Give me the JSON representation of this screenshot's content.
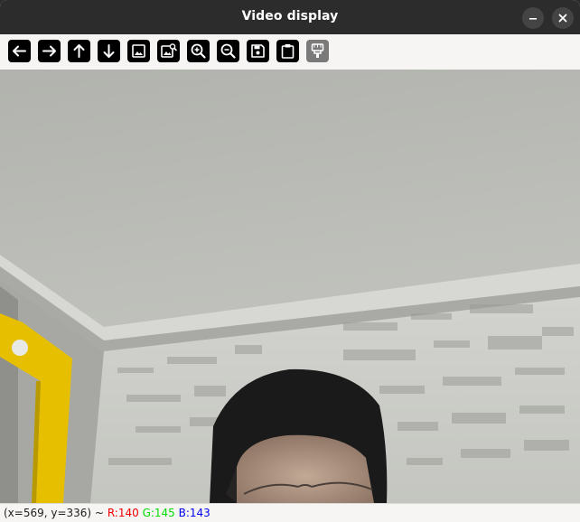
{
  "window": {
    "title": "Video display"
  },
  "titlebar_buttons": [
    {
      "name": "minimize",
      "icon": "minimize-icon"
    },
    {
      "name": "close",
      "icon": "close-icon"
    }
  ],
  "toolbar": {
    "tools": [
      {
        "icon": "arrow-left-icon",
        "enabled": true
      },
      {
        "icon": "arrow-right-icon",
        "enabled": true
      },
      {
        "icon": "arrow-up-icon",
        "enabled": true
      },
      {
        "icon": "arrow-down-icon",
        "enabled": true
      },
      {
        "icon": "image-icon",
        "enabled": true
      },
      {
        "icon": "image-search-icon",
        "enabled": true
      },
      {
        "icon": "zoom-in-icon",
        "enabled": true
      },
      {
        "icon": "zoom-out-icon",
        "enabled": true
      },
      {
        "icon": "save-icon",
        "enabled": true
      },
      {
        "icon": "clipboard-icon",
        "enabled": true
      },
      {
        "icon": "paint-brush-icon",
        "enabled": false
      }
    ]
  },
  "video": {
    "description_icon": "webcam-frame"
  },
  "status": {
    "coords": "(x=569, y=336) ~",
    "r": "R:140",
    "g": "G:145",
    "b": "B:143",
    "colors": {
      "r": "#ee0000",
      "g": "#00dd00",
      "b": "#0000ee"
    }
  }
}
